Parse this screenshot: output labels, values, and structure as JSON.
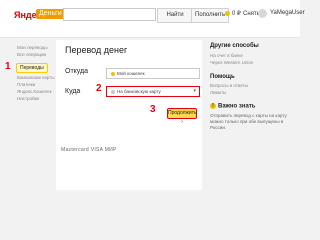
{
  "header": {
    "logo": "Яндекс",
    "logo_badge": "Деньги",
    "search_placeholder": "",
    "find_label": "Найти",
    "topup_label": "Пополнить",
    "balance": "0 ₽",
    "send_label": "Снять",
    "username": "YaMegaUser"
  },
  "sidebar": {
    "items": [
      {
        "label": "Мои переводы"
      },
      {
        "label": "Все операции"
      },
      {
        "label": "Переводы"
      },
      {
        "label": "Банковские карты"
      },
      {
        "label": "Платежи"
      },
      {
        "label": "Яндекс.Кошелек"
      },
      {
        "label": "Настройки"
      }
    ]
  },
  "main": {
    "title": "Перевод денег",
    "from_label": "Откуда",
    "from_value": "Мой кошелек",
    "to_label": "Куда",
    "to_value": "На банковскую карту",
    "submit_label": "Продолжить",
    "footer_logos": "Mastercard  VISA  МИР"
  },
  "annotations": {
    "a1": "1",
    "a2": "2",
    "a3": "3"
  },
  "right": {
    "other_title": "Другие способы",
    "other_links": [
      "На счет в банке",
      "Через Western Union"
    ],
    "help_title": "Помощь",
    "help_links": [
      "Вопросы и ответы",
      "Лимиты"
    ],
    "important_title": "Важно знать",
    "important_text": "Отправить перевод с карты на карту можно только при обе выпущены в России."
  },
  "colors": {
    "accent": "#ffdb4d",
    "annotation": "#e60012",
    "brand": "#e60000"
  }
}
